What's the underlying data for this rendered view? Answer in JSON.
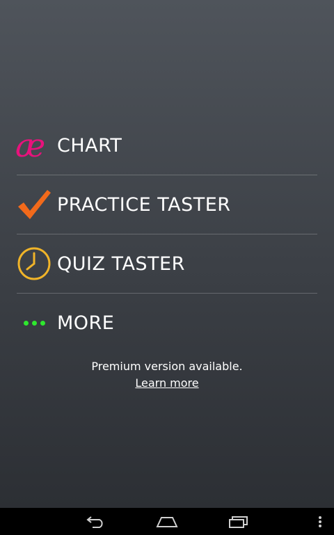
{
  "menu": {
    "items": [
      {
        "label": "CHART",
        "icon": "ae-ligature-icon",
        "icon_glyph": "æ",
        "icon_color": "#e8127c"
      },
      {
        "label": "PRACTICE TASTER",
        "icon": "checkmark-icon",
        "icon_color": "#f26a1b"
      },
      {
        "label": "QUIZ TASTER",
        "icon": "clock-icon",
        "icon_color": "#f0b429"
      },
      {
        "label": "MORE",
        "icon": "more-dots-icon",
        "icon_color": "#2ee82e"
      }
    ]
  },
  "premium": {
    "message": "Premium version available.",
    "link_label": "Learn more"
  },
  "navbar": {
    "buttons": [
      "back-icon",
      "home-icon",
      "recent-apps-icon",
      "overflow-menu-icon"
    ]
  },
  "colors": {
    "background_top": "#4f545b",
    "background_bottom": "#2c2f34",
    "navbar": "#000000"
  }
}
